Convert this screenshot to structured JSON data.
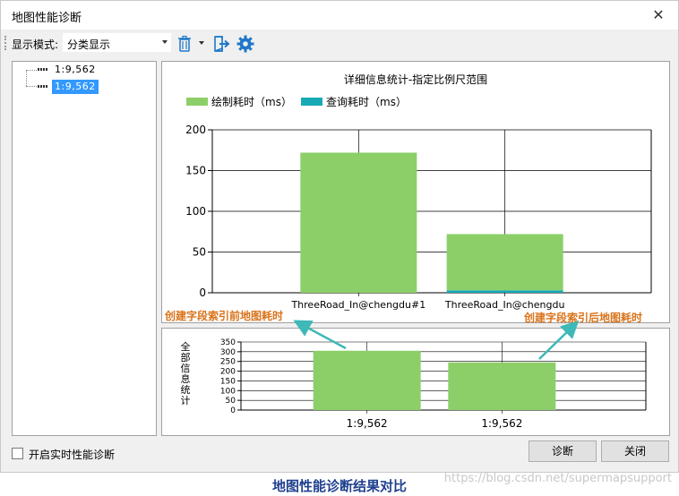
{
  "window": {
    "title": "地图性能诊断",
    "close_glyph": "✕"
  },
  "toolbar": {
    "mode_label": "显示模式:",
    "mode_value": "分类显示"
  },
  "tree": {
    "items": [
      {
        "label": "1:9,562",
        "selected": false
      },
      {
        "label": "1:9,562",
        "selected": true
      }
    ]
  },
  "icons": {
    "trash": "trash-icon",
    "export": "export-icon",
    "gear": "gear-icon"
  },
  "colors": {
    "draw": "#8ccf69",
    "query": "#17a9b5",
    "annotation": "#d9731a",
    "arrow": "#3fb8b8",
    "selection": "#3399ff"
  },
  "chart_data": [
    {
      "type": "bar",
      "stacked": true,
      "title": "详细信息统计-指定比例尺范围",
      "categories": [
        "ThreeRoad_In@chengdu#1",
        "ThreeRoad_In@chengdu"
      ],
      "series": [
        {
          "name": "绘制耗时（ms）",
          "values": [
            172,
            69
          ]
        },
        {
          "name": "查询耗时（ms）",
          "values": [
            0,
            3
          ]
        }
      ],
      "ylim": [
        0,
        200
      ],
      "yticks": [
        0,
        50,
        100,
        150,
        200
      ],
      "grid": true,
      "legend": "top-left"
    },
    {
      "type": "bar",
      "title": "",
      "ylabel": "全部信息统计",
      "categories": [
        "1:9,562",
        "1:9,562"
      ],
      "series": [
        {
          "values": [
            305,
            245
          ]
        }
      ],
      "ylim": [
        0,
        350
      ],
      "yticks": [
        0,
        50,
        100,
        150,
        200,
        250,
        300,
        350
      ],
      "grid": true
    }
  ],
  "annotations": {
    "before": "创建字段索引前地图耗时",
    "after": "创建字段索引后地图耗时"
  },
  "footer": {
    "realtime_label": "开启实时性能诊断",
    "diagnose_button": "诊断",
    "close_button": "关闭"
  },
  "caption": "地图性能诊断结果对比",
  "watermark": "https://blog.csdn.net/supermapsupport"
}
